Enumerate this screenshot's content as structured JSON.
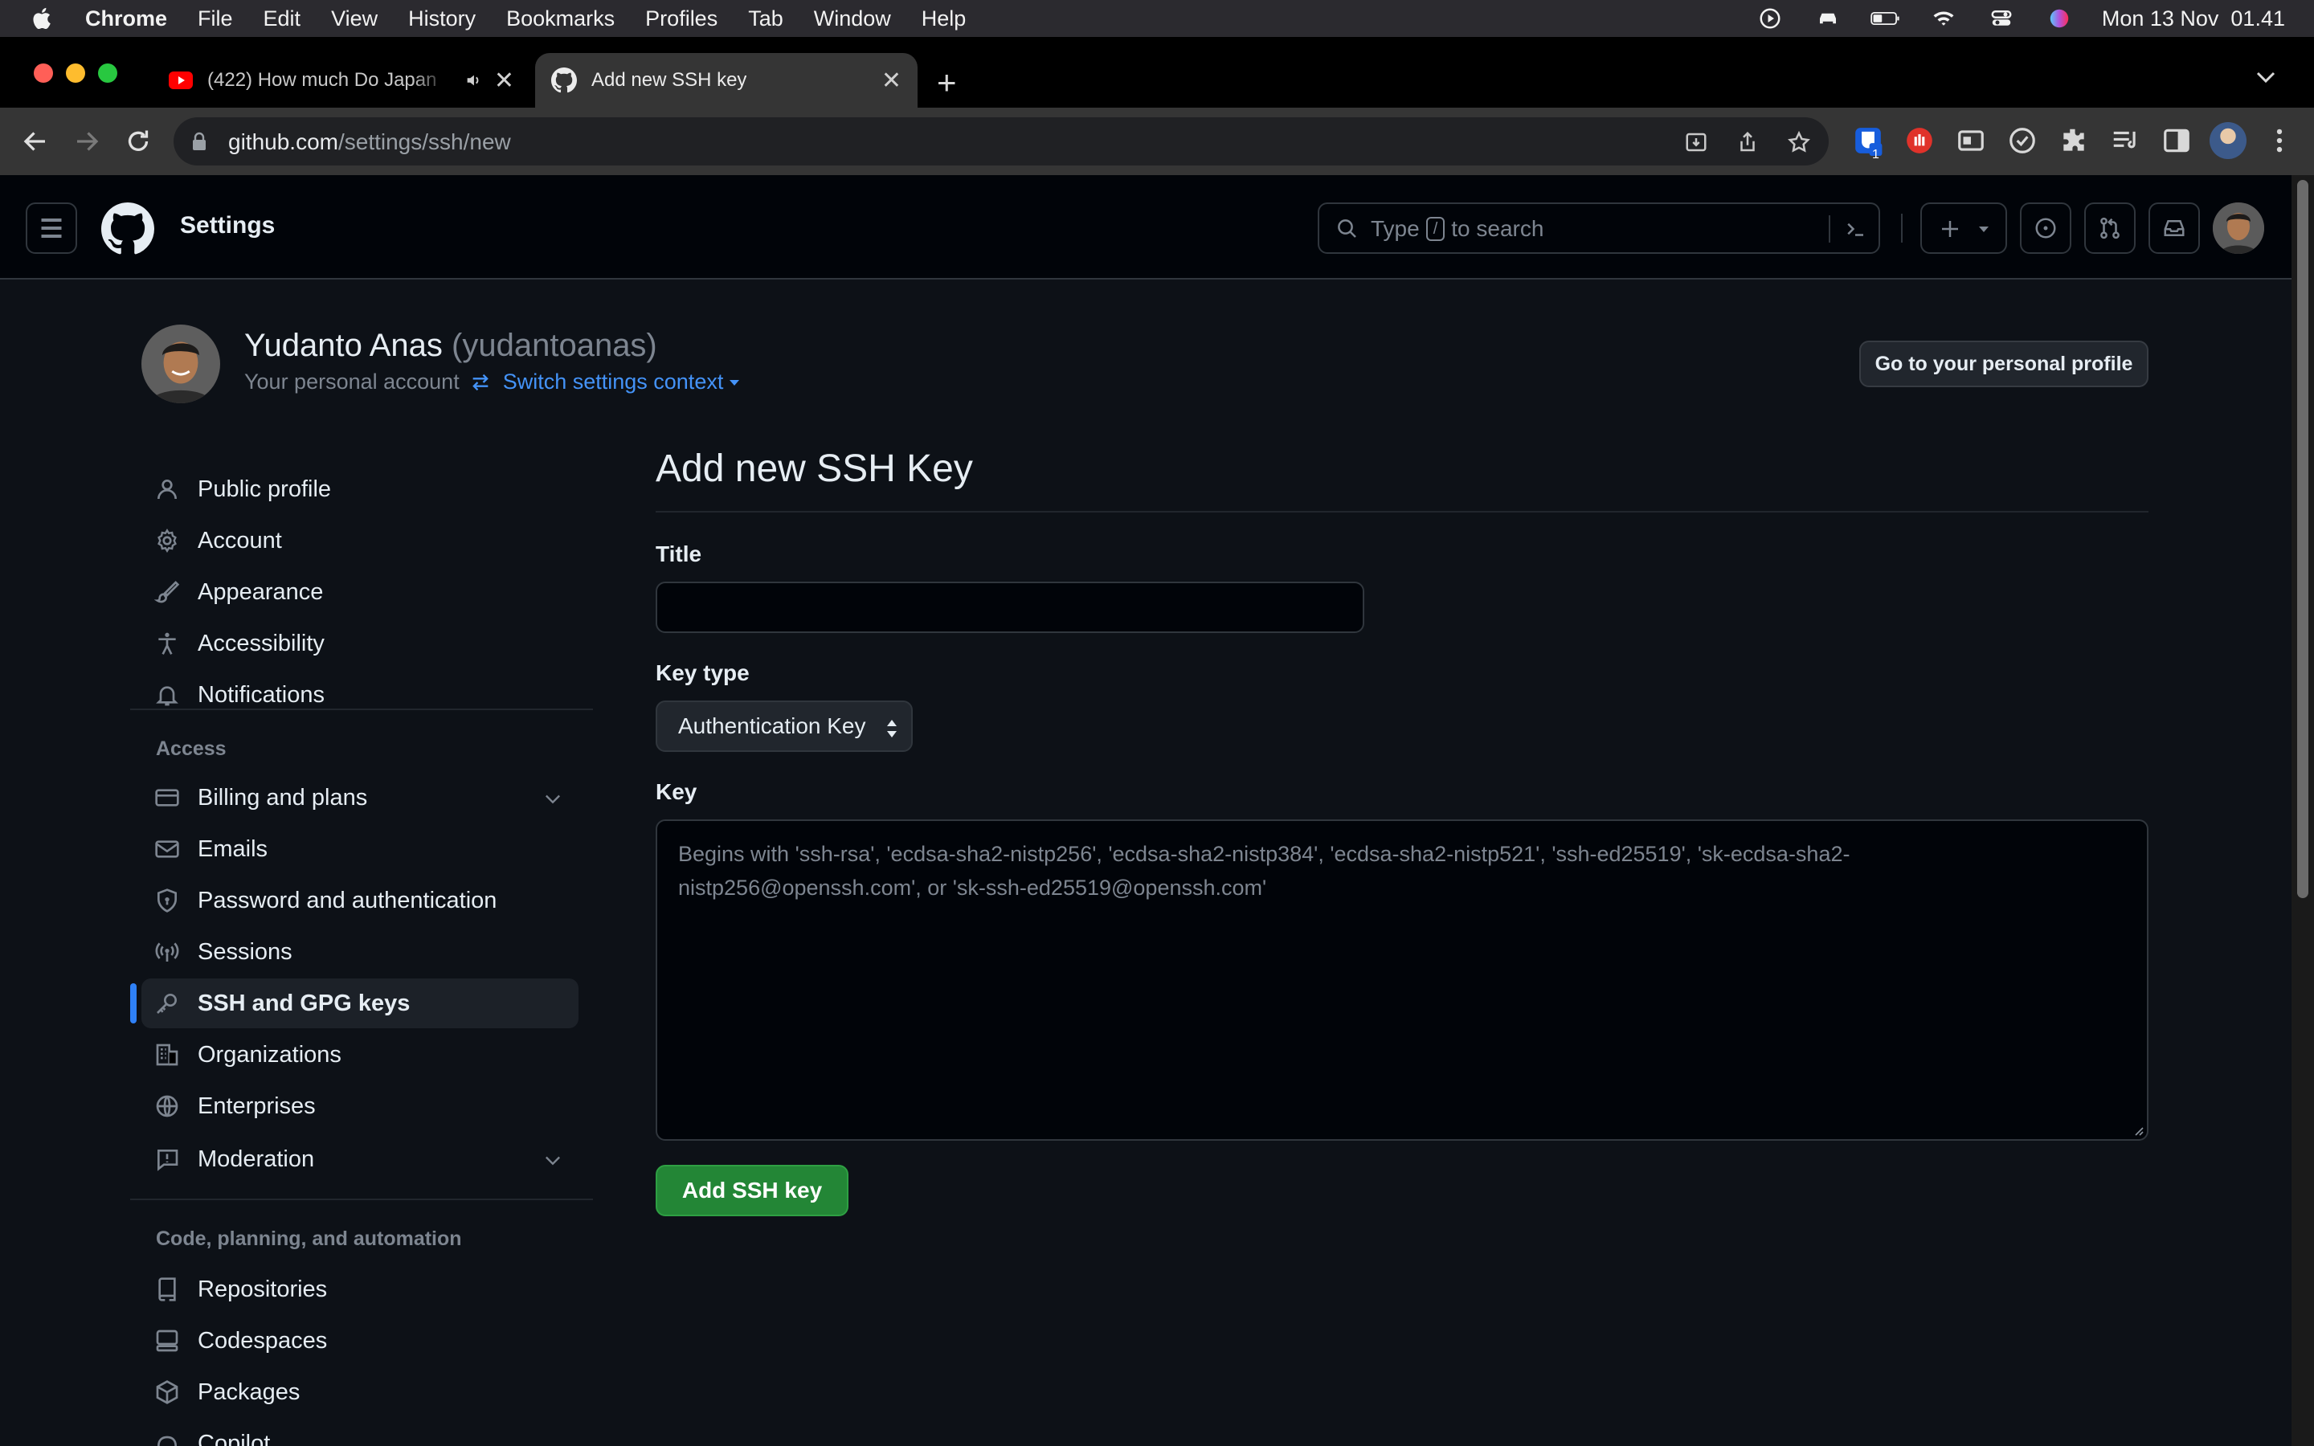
{
  "menubar": {
    "app_name": "Chrome",
    "items": [
      "File",
      "Edit",
      "View",
      "History",
      "Bookmarks",
      "Profiles",
      "Tab",
      "Window",
      "Help"
    ],
    "clock": "Mon 13 Nov  01.41"
  },
  "tabs": [
    {
      "title": "(422) How much Do Japan",
      "icon": "youtube-icon",
      "state": "inactive",
      "audio": "speaker-icon"
    },
    {
      "title": "Add new SSH key",
      "icon": "github-icon",
      "state": "active"
    }
  ],
  "toolbar": {
    "url_host": "github.com",
    "url_path": "/settings/ssh/new",
    "extension_badge": "1"
  },
  "header": {
    "title": "Settings",
    "search_prefix": "Type",
    "search_key": "/",
    "search_suffix": "to search"
  },
  "account": {
    "name": "Yudanto Anas",
    "handle": "(yudantoanas)",
    "subtitle": "Your personal account",
    "switch_label": "Switch settings context",
    "profile_button": "Go to your personal profile"
  },
  "sidebar": {
    "items_top": [
      {
        "label": "Public profile",
        "icon": "person-icon"
      },
      {
        "label": "Account",
        "icon": "gear-icon"
      },
      {
        "label": "Appearance",
        "icon": "paintbrush-icon"
      },
      {
        "label": "Accessibility",
        "icon": "accessibility-icon"
      },
      {
        "label": "Notifications",
        "icon": "bell-icon"
      }
    ],
    "access_heading": "Access",
    "items_access": [
      {
        "label": "Billing and plans",
        "icon": "credit-card-icon",
        "expandable": true
      },
      {
        "label": "Emails",
        "icon": "mail-icon"
      },
      {
        "label": "Password and authentication",
        "icon": "shield-lock-icon"
      },
      {
        "label": "Sessions",
        "icon": "broadcast-icon"
      },
      {
        "label": "SSH and GPG keys",
        "icon": "key-icon",
        "selected": true
      },
      {
        "label": "Organizations",
        "icon": "organization-icon"
      },
      {
        "label": "Enterprises",
        "icon": "globe-icon"
      },
      {
        "label": "Moderation",
        "icon": "report-icon",
        "expandable": true
      }
    ],
    "code_heading": "Code, planning, and automation",
    "items_code": [
      {
        "label": "Repositories",
        "icon": "repo-icon"
      },
      {
        "label": "Codespaces",
        "icon": "codespaces-icon"
      },
      {
        "label": "Packages",
        "icon": "package-icon"
      },
      {
        "label": "Copilot",
        "icon": "copilot-icon"
      }
    ]
  },
  "form": {
    "heading": "Add new SSH Key",
    "title_label": "Title",
    "title_value": "",
    "key_type_label": "Key type",
    "key_type_value": "Authentication Key",
    "key_label": "Key",
    "key_placeholder": "Begins with 'ssh-rsa', 'ecdsa-sha2-nistp256', 'ecdsa-sha2-nistp384', 'ecdsa-sha2-nistp521', 'ssh-ed25519', 'sk-ecdsa-sha2-nistp256@openssh.com', or 'sk-ssh-ed25519@openssh.com'",
    "submit_label": "Add SSH key"
  },
  "colors": {
    "accent_blue": "#2f81f7",
    "link_blue": "#4493f8",
    "primary_green": "#238636",
    "background": "#0d1117",
    "header_background": "#010409"
  }
}
